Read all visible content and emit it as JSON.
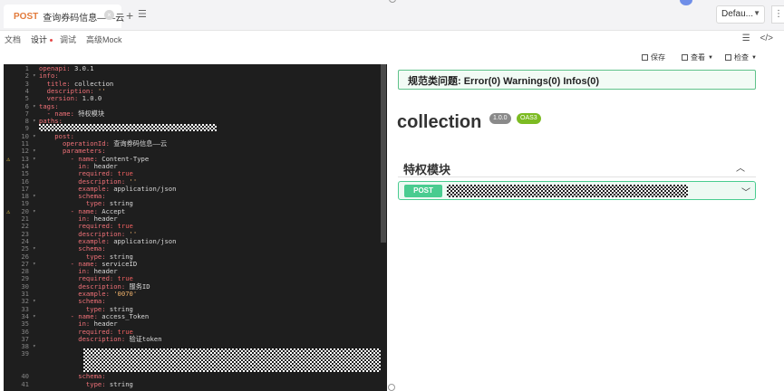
{
  "tab": {
    "method": "POST",
    "title": "查询券码信息——云",
    "close": "×"
  },
  "tabbar": {
    "add": "+",
    "list": "☰",
    "env_label": "Defau...",
    "env_caret": "▼",
    "more": "⋮"
  },
  "subtabs": [
    {
      "label": "文档",
      "active": false
    },
    {
      "label": "设计",
      "active": true
    },
    {
      "label": "调试",
      "active": false
    },
    {
      "label": "高级Mock",
      "active": false
    }
  ],
  "sub_icons": {
    "menu": "☰",
    "code": "</>"
  },
  "toolbar": {
    "save": "保存",
    "view": "查看",
    "check": "检查"
  },
  "editor": {
    "lines": [
      {
        "n": "1",
        "code": [
          [
            "k",
            "openapi: "
          ],
          [
            "v",
            "3.0.1"
          ]
        ]
      },
      {
        "n": "2",
        "code": [
          [
            "k",
            "info:"
          ]
        ]
      },
      {
        "n": "3",
        "code": [
          [
            "k",
            "  title: "
          ],
          [
            "v",
            "collection"
          ]
        ]
      },
      {
        "n": "4",
        "code": [
          [
            "k",
            "  description: "
          ],
          [
            "s",
            "''"
          ]
        ]
      },
      {
        "n": "5",
        "code": [
          [
            "k",
            "  version: "
          ],
          [
            "v",
            "1.0.0"
          ]
        ]
      },
      {
        "n": "6",
        "code": [
          [
            "k",
            "tags:"
          ]
        ]
      },
      {
        "n": "7",
        "code": [
          [
            "k",
            "  - name: "
          ],
          [
            "v",
            "特权模块"
          ]
        ]
      },
      {
        "n": "8",
        "code": [
          [
            "k",
            "paths:"
          ]
        ]
      },
      {
        "n": "9",
        "code": []
      },
      {
        "n": "10",
        "code": [
          [
            "k",
            "    post:"
          ]
        ]
      },
      {
        "n": "11",
        "code": [
          [
            "k",
            "      operationId: "
          ],
          [
            "v",
            "查询券码信息——云"
          ]
        ]
      },
      {
        "n": "12",
        "code": [
          [
            "k",
            "      parameters:"
          ]
        ]
      },
      {
        "n": "13",
        "warn": true,
        "code": [
          [
            "k",
            "        - name: "
          ],
          [
            "v",
            "Content-Type"
          ]
        ]
      },
      {
        "n": "14",
        "code": [
          [
            "k",
            "          in: "
          ],
          [
            "v",
            "header"
          ]
        ]
      },
      {
        "n": "15",
        "code": [
          [
            "k",
            "          required: "
          ],
          [
            "b",
            "true"
          ]
        ]
      },
      {
        "n": "16",
        "code": [
          [
            "k",
            "          description: "
          ],
          [
            "s",
            "''"
          ]
        ]
      },
      {
        "n": "17",
        "code": [
          [
            "k",
            "          example: "
          ],
          [
            "v",
            "application/json"
          ]
        ]
      },
      {
        "n": "18",
        "code": [
          [
            "k",
            "          schema:"
          ]
        ]
      },
      {
        "n": "19",
        "code": [
          [
            "k",
            "            type: "
          ],
          [
            "v",
            "string"
          ]
        ]
      },
      {
        "n": "20",
        "warn": true,
        "code": [
          [
            "k",
            "        - name: "
          ],
          [
            "v",
            "Accept"
          ]
        ]
      },
      {
        "n": "21",
        "code": [
          [
            "k",
            "          in: "
          ],
          [
            "v",
            "header"
          ]
        ]
      },
      {
        "n": "22",
        "code": [
          [
            "k",
            "          required: "
          ],
          [
            "b",
            "true"
          ]
        ]
      },
      {
        "n": "23",
        "code": [
          [
            "k",
            "          description: "
          ],
          [
            "s",
            "''"
          ]
        ]
      },
      {
        "n": "24",
        "code": [
          [
            "k",
            "          example: "
          ],
          [
            "v",
            "application/json"
          ]
        ]
      },
      {
        "n": "25",
        "code": [
          [
            "k",
            "          schema:"
          ]
        ]
      },
      {
        "n": "26",
        "code": [
          [
            "k",
            "            type: "
          ],
          [
            "v",
            "string"
          ]
        ]
      },
      {
        "n": "27",
        "code": [
          [
            "k",
            "        - name: "
          ],
          [
            "v",
            "serviceID"
          ]
        ]
      },
      {
        "n": "28",
        "code": [
          [
            "k",
            "          in: "
          ],
          [
            "v",
            "header"
          ]
        ]
      },
      {
        "n": "29",
        "code": [
          [
            "k",
            "          required: "
          ],
          [
            "b",
            "true"
          ]
        ]
      },
      {
        "n": "30",
        "code": [
          [
            "k",
            "          description: "
          ],
          [
            "v",
            "服务ID"
          ]
        ]
      },
      {
        "n": "31",
        "code": [
          [
            "k",
            "          example: "
          ],
          [
            "s",
            "'0070'"
          ]
        ]
      },
      {
        "n": "32",
        "code": [
          [
            "k",
            "          schema:"
          ]
        ]
      },
      {
        "n": "33",
        "code": [
          [
            "k",
            "            type: "
          ],
          [
            "v",
            "string"
          ]
        ]
      },
      {
        "n": "34",
        "code": [
          [
            "k",
            "        - name: "
          ],
          [
            "v",
            "access_Token"
          ]
        ]
      },
      {
        "n": "35",
        "code": [
          [
            "k",
            "          in: "
          ],
          [
            "v",
            "header"
          ]
        ]
      },
      {
        "n": "36",
        "code": [
          [
            "k",
            "          required: "
          ],
          [
            "b",
            "true"
          ]
        ]
      },
      {
        "n": "37",
        "code": [
          [
            "k",
            "          description: "
          ],
          [
            "v",
            "验证token"
          ]
        ]
      },
      {
        "n": "38",
        "code": []
      },
      {
        "n": "39",
        "code": []
      },
      {
        "n": "",
        "code": []
      },
      {
        "n": "",
        "code": []
      },
      {
        "n": "40",
        "code": [
          [
            "k",
            "          schema:"
          ]
        ]
      },
      {
        "n": "41",
        "code": [
          [
            "k",
            "            type: "
          ],
          [
            "v",
            "string"
          ]
        ]
      }
    ]
  },
  "preview": {
    "banner": "规范类问题: Error(0) Warnings(0) Infos(0)",
    "title": "collection",
    "version": "1.0.0",
    "spec": "OAS3",
    "tag": "特权模块",
    "tag_chevron": "︿",
    "operation": {
      "method": "POST",
      "chevron": "﹀"
    }
  }
}
